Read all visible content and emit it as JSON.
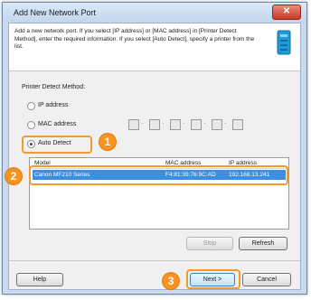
{
  "window": {
    "title": "Add New Network Port",
    "close_glyph": "✕"
  },
  "header": {
    "description": "Add a new network port. If you select [IP address] or [MAC address] in [Printer Detect Method], enter the required information. If you select [Auto Detect], specify a printer from the list.",
    "icon": "printer-port-icon"
  },
  "detect_method": {
    "label": "Printer Detect Method:",
    "options": [
      {
        "label": "IP address",
        "selected": false
      },
      {
        "label": "MAC address",
        "selected": false
      },
      {
        "label": "Auto Detect",
        "selected": true
      }
    ]
  },
  "printer_list": {
    "columns": [
      "Model",
      "MAC address",
      "IP address"
    ],
    "rows": [
      {
        "model": "Canon MF210 Series",
        "mac": "F4:81:39:76:9C:AD",
        "ip": "192.168.13.241",
        "selected": true
      }
    ]
  },
  "buttons": {
    "stop": "Stop",
    "refresh": "Refresh",
    "help": "Help",
    "next": "Next >",
    "cancel": "Cancel"
  },
  "callouts": [
    "1",
    "2",
    "3"
  ],
  "colors": {
    "callout": "#f7931e",
    "selection": "#3b8ee0",
    "titlebar": "#c3d6ee"
  }
}
